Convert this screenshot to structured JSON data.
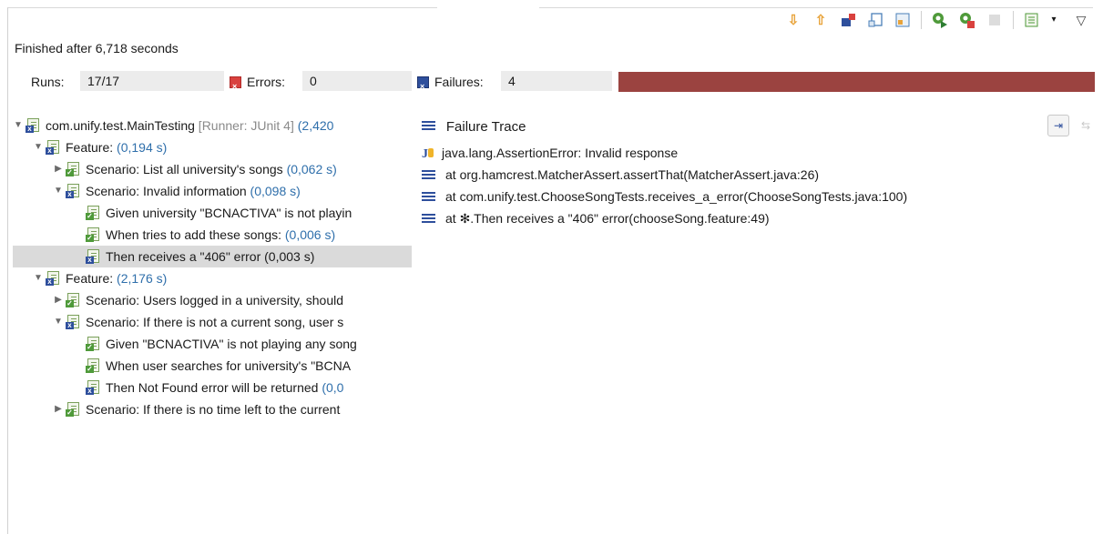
{
  "status": {
    "finished_text": "Finished after 6,718 seconds"
  },
  "toolbar": {
    "buttons": [
      {
        "name": "next-failure-icon",
        "glyph": "⇩",
        "color": "#e8a33a"
      },
      {
        "name": "previous-failure-icon",
        "glyph": "⇧",
        "color": "#e8a33a"
      },
      {
        "name": "show-failures-only-icon",
        "glyph": "▪",
        "color": "#2e4f9c"
      },
      {
        "name": "scroll-lock-icon",
        "glyph": "⊡",
        "color": "#4a7fb8"
      },
      {
        "name": "show-skipped-icon",
        "glyph": "▦",
        "color": "#4a7fb8"
      },
      {
        "name": "rerun-test-icon",
        "glyph": "↻",
        "color": "#4f9a3a"
      },
      {
        "name": "rerun-failures-first-icon",
        "glyph": "↻",
        "color": "#c0392b"
      },
      {
        "name": "stop-run-icon",
        "glyph": "■",
        "color": "#d6d6d6"
      },
      {
        "name": "test-run-history-icon",
        "glyph": "☰",
        "color": "#4f9a3a"
      },
      {
        "name": "view-menu-icon",
        "glyph": "▽",
        "color": "#444444"
      }
    ]
  },
  "counters": {
    "runs_label": "Runs:",
    "runs_value": "17/17",
    "errors_label": "Errors:",
    "errors_value": "0",
    "failures_label": "Failures:",
    "failures_value": "4",
    "progress_fraction": 1.0,
    "progress_color": "#9b4340"
  },
  "tree": {
    "rows": [
      {
        "name": "tree-row-main-testing",
        "indent": 0,
        "twisty": "▼",
        "status": "fail",
        "label": "com.unify.test.MainTesting",
        "extra": " [Runner: JUnit 4] ",
        "time": "(2,420"
      },
      {
        "name": "tree-row-feature-1",
        "indent": 1,
        "twisty": "▼",
        "status": "fail",
        "label": "Feature: ",
        "extra": "",
        "time": "(0,194 s)"
      },
      {
        "name": "tree-row-scenario-list-songs",
        "indent": 2,
        "twisty": "▶",
        "status": "ok",
        "label": "Scenario: List all university's songs ",
        "extra": "",
        "time": "(0,062 s)"
      },
      {
        "name": "tree-row-scenario-invalid-info",
        "indent": 2,
        "twisty": "▼",
        "status": "fail",
        "label": "Scenario: Invalid information ",
        "extra": "",
        "time": "(0,098 s)"
      },
      {
        "name": "tree-row-given-university",
        "indent": 3,
        "twisty": "",
        "status": "ok",
        "label": "Given university \"BCNACTIVA\" is not playin",
        "extra": "",
        "time": ""
      },
      {
        "name": "tree-row-when-add-songs",
        "indent": 3,
        "twisty": "",
        "status": "ok",
        "label": "When tries to add these songs: ",
        "extra": "",
        "time": "(0,006 s)"
      },
      {
        "name": "tree-row-then-406",
        "indent": 3,
        "twisty": "",
        "status": "fail",
        "label": "Then receives a \"406\" error (0,003 s)",
        "extra": "",
        "time": "",
        "selected": true
      },
      {
        "name": "tree-row-feature-2",
        "indent": 1,
        "twisty": "▼",
        "status": "fail",
        "label": "Feature: ",
        "extra": "",
        "time": "(2,176 s)"
      },
      {
        "name": "tree-row-scenario-users-logged",
        "indent": 2,
        "twisty": "▶",
        "status": "ok",
        "label": "Scenario: Users logged in a university, should",
        "extra": "",
        "time": ""
      },
      {
        "name": "tree-row-scenario-no-current-song",
        "indent": 2,
        "twisty": "▼",
        "status": "fail",
        "label": "Scenario: If there is not a current song, user s",
        "extra": "",
        "time": ""
      },
      {
        "name": "tree-row-given-not-playing",
        "indent": 3,
        "twisty": "",
        "status": "ok",
        "label": "Given \"BCNACTIVA\" is not playing any song",
        "extra": "",
        "time": ""
      },
      {
        "name": "tree-row-when-user-searches",
        "indent": 3,
        "twisty": "",
        "status": "ok",
        "label": "When user searches for university's \"BCNA",
        "extra": "",
        "time": ""
      },
      {
        "name": "tree-row-then-not-found",
        "indent": 3,
        "twisty": "",
        "status": "fail",
        "label": "Then Not Found error will be returned ",
        "extra": "",
        "time": "(0,0"
      },
      {
        "name": "tree-row-scenario-no-time-left",
        "indent": 2,
        "twisty": "▶",
        "status": "ok",
        "label": "Scenario: If there is no time left to the current",
        "extra": "",
        "time": ""
      }
    ]
  },
  "trace": {
    "title": "Failure Trace",
    "lines": [
      {
        "kind": "junit",
        "text": "java.lang.AssertionError: Invalid response"
      },
      {
        "kind": "frame",
        "text": "at org.hamcrest.MatcherAssert.assertThat(MatcherAssert.java:26)"
      },
      {
        "kind": "frame",
        "text": "at com.unify.test.ChooseSongTests.receives_a_error(ChooseSongTests.java:100)"
      },
      {
        "kind": "frame",
        "text": "at ✻.Then receives a \"406\" error(chooseSong.feature:49)"
      }
    ]
  }
}
